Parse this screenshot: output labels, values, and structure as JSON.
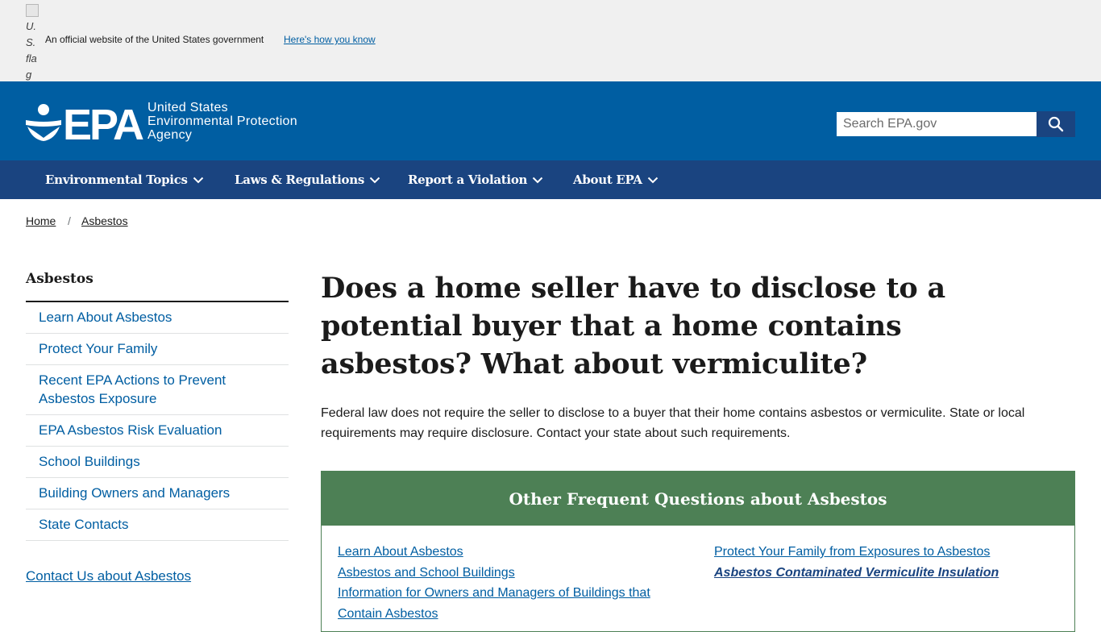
{
  "gov_banner": {
    "flag_alt": "U.S. flag",
    "official_text": "An official website of the United States government",
    "how_link": "Here's how you know"
  },
  "header": {
    "logo_wordmark": "EPA",
    "agency_line1": "United States",
    "agency_line2": "Environmental Protection",
    "agency_line3": "Agency",
    "search_placeholder": "Search EPA.gov",
    "search_button_icon": "search-icon"
  },
  "nav": {
    "items": [
      {
        "label": "Environmental Topics"
      },
      {
        "label": "Laws & Regulations"
      },
      {
        "label": "Report a Violation"
      },
      {
        "label": "About EPA"
      }
    ]
  },
  "breadcrumb": {
    "home": "Home",
    "separator": "/",
    "current": "Asbestos"
  },
  "sidebar": {
    "title": "Asbestos",
    "items": [
      {
        "label": "Learn About Asbestos"
      },
      {
        "label": "Protect Your Family"
      },
      {
        "label": "Recent EPA Actions to Prevent Asbestos Exposure"
      },
      {
        "label": "EPA Asbestos Risk Evaluation"
      },
      {
        "label": "School Buildings"
      },
      {
        "label": "Building Owners and Managers"
      },
      {
        "label": "State Contacts"
      }
    ],
    "contact_link": "Contact Us about Asbestos"
  },
  "main": {
    "title": "Does a home seller have to disclose to a potential buyer that a home contains asbestos? What about vermiculite?",
    "paragraph": "Federal law does not require the seller to disclose to a buyer that their home contains asbestos or vermiculite. State or local requirements may require disclosure. Contact your state about such requirements.",
    "faq": {
      "heading": "Other Frequent Questions about Asbestos",
      "left_links": [
        {
          "label": "Learn About Asbestos"
        },
        {
          "label": "Asbestos and School Buildings"
        },
        {
          "label": "Information for Owners and Managers of Buildings that Contain Asbestos"
        }
      ],
      "right_links": [
        {
          "label": "Protect Your Family from Exposures to Asbestos"
        },
        {
          "label": "Asbestos Contaminated Vermiculite Insulation"
        }
      ]
    }
  },
  "colors": {
    "header_blue": "#005ea2",
    "nav_navy": "#1a4480",
    "faq_green": "#4d8055",
    "link_blue": "#005ea2"
  }
}
